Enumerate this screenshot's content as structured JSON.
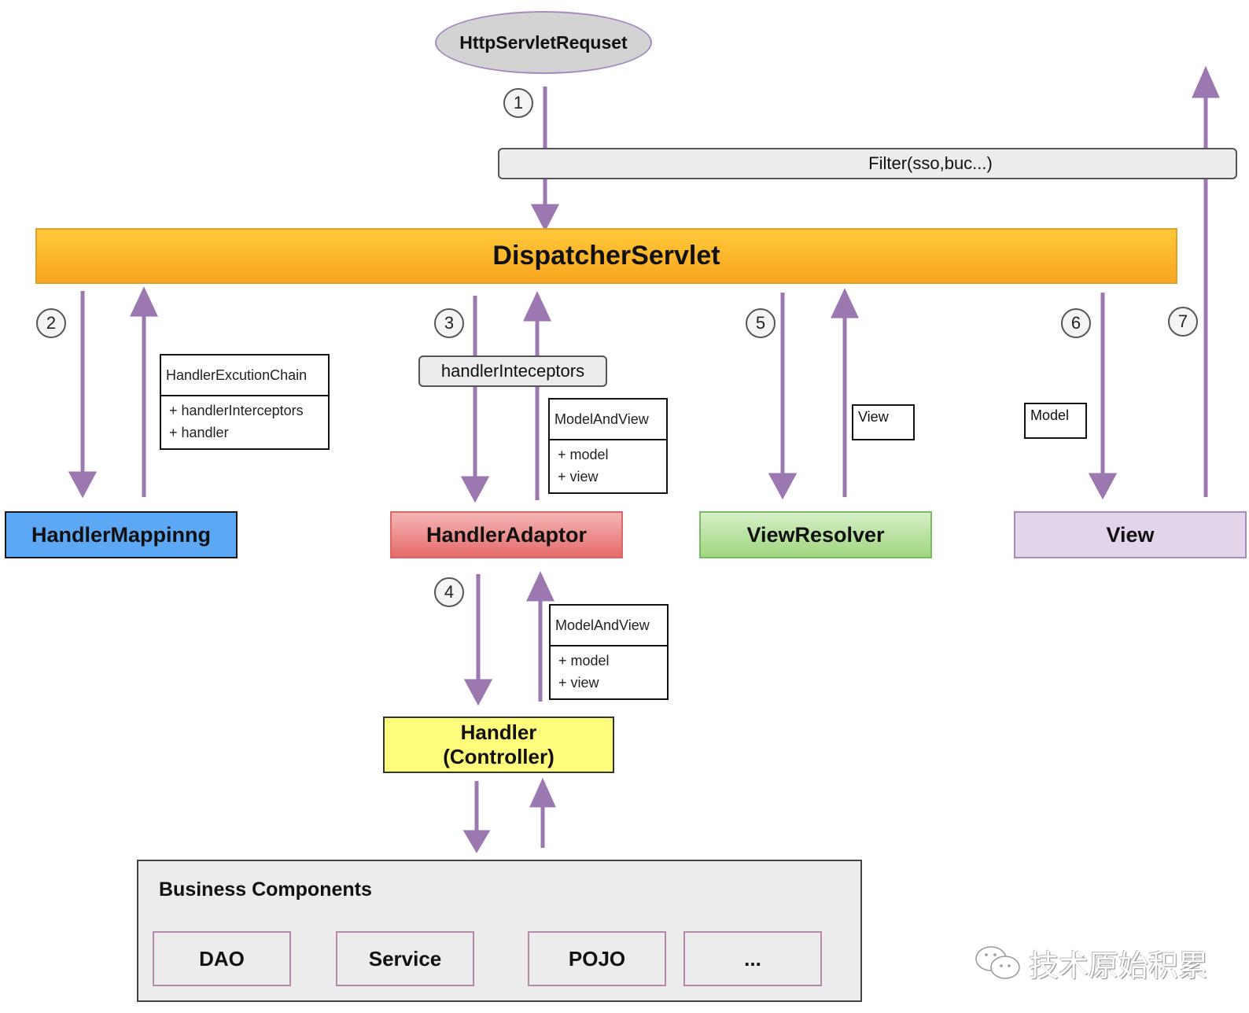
{
  "request": {
    "label": "HttpServletRequset"
  },
  "filter": {
    "label": "Filter(sso,buc...)"
  },
  "dispatcher": {
    "label": "DispatcherServlet"
  },
  "steps": [
    "1",
    "2",
    "3",
    "4",
    "5",
    "6",
    "7"
  ],
  "components": {
    "handler_mapping": "HandlerMappinng",
    "handler_adaptor": "HandlerAdaptor",
    "view_resolver": "ViewResolver",
    "view": "View",
    "handler_line1": "Handler",
    "handler_line2": "(Controller)"
  },
  "uml": {
    "execution_chain": {
      "title": "HandlerExcutionChain",
      "fields": [
        "+ handlerInterceptors",
        "+ handler"
      ]
    },
    "model_and_view_top": {
      "title": "ModelAndView",
      "fields": [
        "+ model",
        "+ view"
      ]
    },
    "model_and_view_bottom": {
      "title": "ModelAndView",
      "fields": [
        "+ model",
        "+ view"
      ]
    }
  },
  "interceptors": {
    "label": "handlerInteceptors"
  },
  "notes": {
    "view": "View",
    "model": "Model"
  },
  "business": {
    "title": "Business Components",
    "items": [
      "DAO",
      "Service",
      "POJO",
      "..."
    ]
  },
  "watermark": {
    "text": "技术原始积累"
  },
  "colors": {
    "arrow": "#9b78b0",
    "dispatcher": "#fbb52c",
    "handler_mapping": "#5ca8f5",
    "handler_adaptor": "#e66b6b",
    "view_resolver": "#9fd67f",
    "view": "#e2d5ea",
    "handler": "#fffb7b"
  }
}
